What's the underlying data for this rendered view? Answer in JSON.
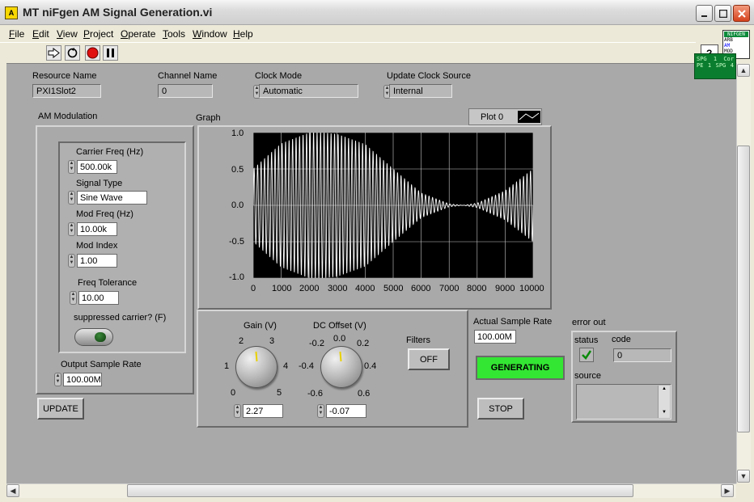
{
  "window": {
    "title": "MT niFgen AM Signal Generation.vi",
    "icon_text": "A"
  },
  "menu": [
    "File",
    "Edit",
    "View",
    "Project",
    "Operate",
    "Tools",
    "Window",
    "Help"
  ],
  "vi_icon": {
    "line1": "NIFGEN",
    "line2": "ARB",
    "line3": "AM",
    "line4": "MOD"
  },
  "connector": {
    "a": "SPG",
    "b": "1",
    "c": "Cor",
    "d": "SPG",
    "e": "PE",
    "f": "1",
    "g": "SPG",
    "h": "4"
  },
  "controls": {
    "resource_name": {
      "label": "Resource Name",
      "value": "PXI1Slot2"
    },
    "channel_name": {
      "label": "Channel Name",
      "value": "0"
    },
    "clock_mode": {
      "label": "Clock Mode",
      "value": "Automatic"
    },
    "update_clock_source": {
      "label": "Update Clock Source",
      "value": "Internal"
    }
  },
  "am": {
    "title": "AM Modulation",
    "carrier_freq": {
      "label": "Carrier Freq (Hz)",
      "value": "500.00k"
    },
    "signal_type": {
      "label": "Signal Type",
      "value": "Sine Wave"
    },
    "mod_freq": {
      "label": "Mod Freq (Hz)",
      "value": "10.00k"
    },
    "mod_index": {
      "label": "Mod Index",
      "value": "1.00"
    },
    "freq_tolerance": {
      "label": "Freq Tolerance",
      "value": "10.00"
    },
    "suppressed_carrier": {
      "label": "suppressed carrier? (F)",
      "state": false
    },
    "output_sample_rate": {
      "label": "Output Sample Rate",
      "value": "100.00M"
    }
  },
  "update_button": "UPDATE",
  "graph": {
    "label": "Graph",
    "legend": "Plot 0",
    "y_ticks": [
      "1.0",
      "0.5",
      "0.0",
      "-0.5",
      "-1.0"
    ],
    "x_ticks": [
      "0",
      "1000",
      "2000",
      "3000",
      "4000",
      "5000",
      "6000",
      "7000",
      "8000",
      "9000",
      "10000"
    ]
  },
  "chart_data": {
    "type": "line",
    "title": "",
    "xlabel": "",
    "ylabel": "",
    "xlim": [
      0,
      10000
    ],
    "ylim": [
      -1.0,
      1.0
    ],
    "grid": true,
    "legend": "top-right",
    "series": [
      {
        "name": "Plot 0",
        "color": "#ffffff",
        "description_points_envelope_x": [
          0,
          1000,
          2000,
          2500,
          3000,
          4000,
          5000,
          6000,
          7000,
          7500,
          8000,
          9000,
          10000
        ],
        "envelope_y": [
          0.5,
          0.85,
          1.0,
          1.0,
          0.98,
          0.84,
          0.5,
          0.17,
          0.02,
          0.0,
          0.03,
          0.2,
          0.5
        ],
        "carrier_cycles": 80
      }
    ]
  },
  "gain": {
    "label": "Gain (V)",
    "value": "2.27",
    "scale": [
      "0",
      "1",
      "2",
      "3",
      "4",
      "5"
    ]
  },
  "dc_offset": {
    "label": "DC Offset (V)",
    "value": "-0.07",
    "scale": [
      "-0.6",
      "-0.4",
      "-0.2",
      "0.0",
      "0.2",
      "0.4",
      "0.6"
    ]
  },
  "filters": {
    "label": "Filters",
    "value": "OFF"
  },
  "actual_sample_rate": {
    "label": "Actual Sample Rate",
    "value": "100.00M"
  },
  "status_indicator": {
    "text": "GENERATING",
    "color": "#33e633"
  },
  "stop_button": "STOP",
  "error_out": {
    "label": "error out",
    "status_label": "status",
    "code_label": "code",
    "code_value": "0",
    "source_label": "source",
    "source_value": ""
  }
}
